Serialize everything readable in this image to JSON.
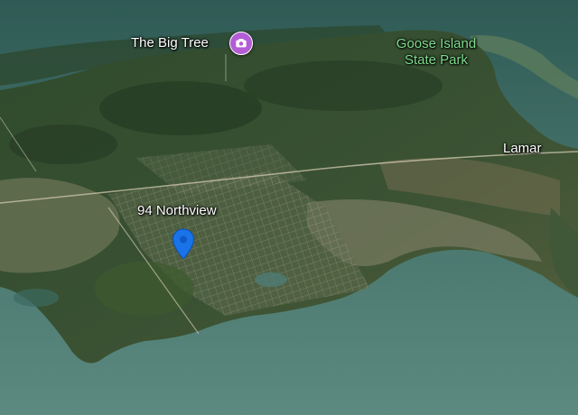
{
  "map": {
    "view": "satellite-3d",
    "places": {
      "big_tree": {
        "label": "The Big Tree",
        "icon": "camera-icon",
        "color": "#b35cd6"
      },
      "goose_island": {
        "label_line1": "Goose Island",
        "label_line2": "State Park",
        "color": "#7fdc8f"
      },
      "lamar": {
        "label": "Lamar"
      },
      "address": {
        "label": "94 Northview",
        "icon": "location-pin-icon",
        "color": "#1a73e8"
      }
    }
  }
}
